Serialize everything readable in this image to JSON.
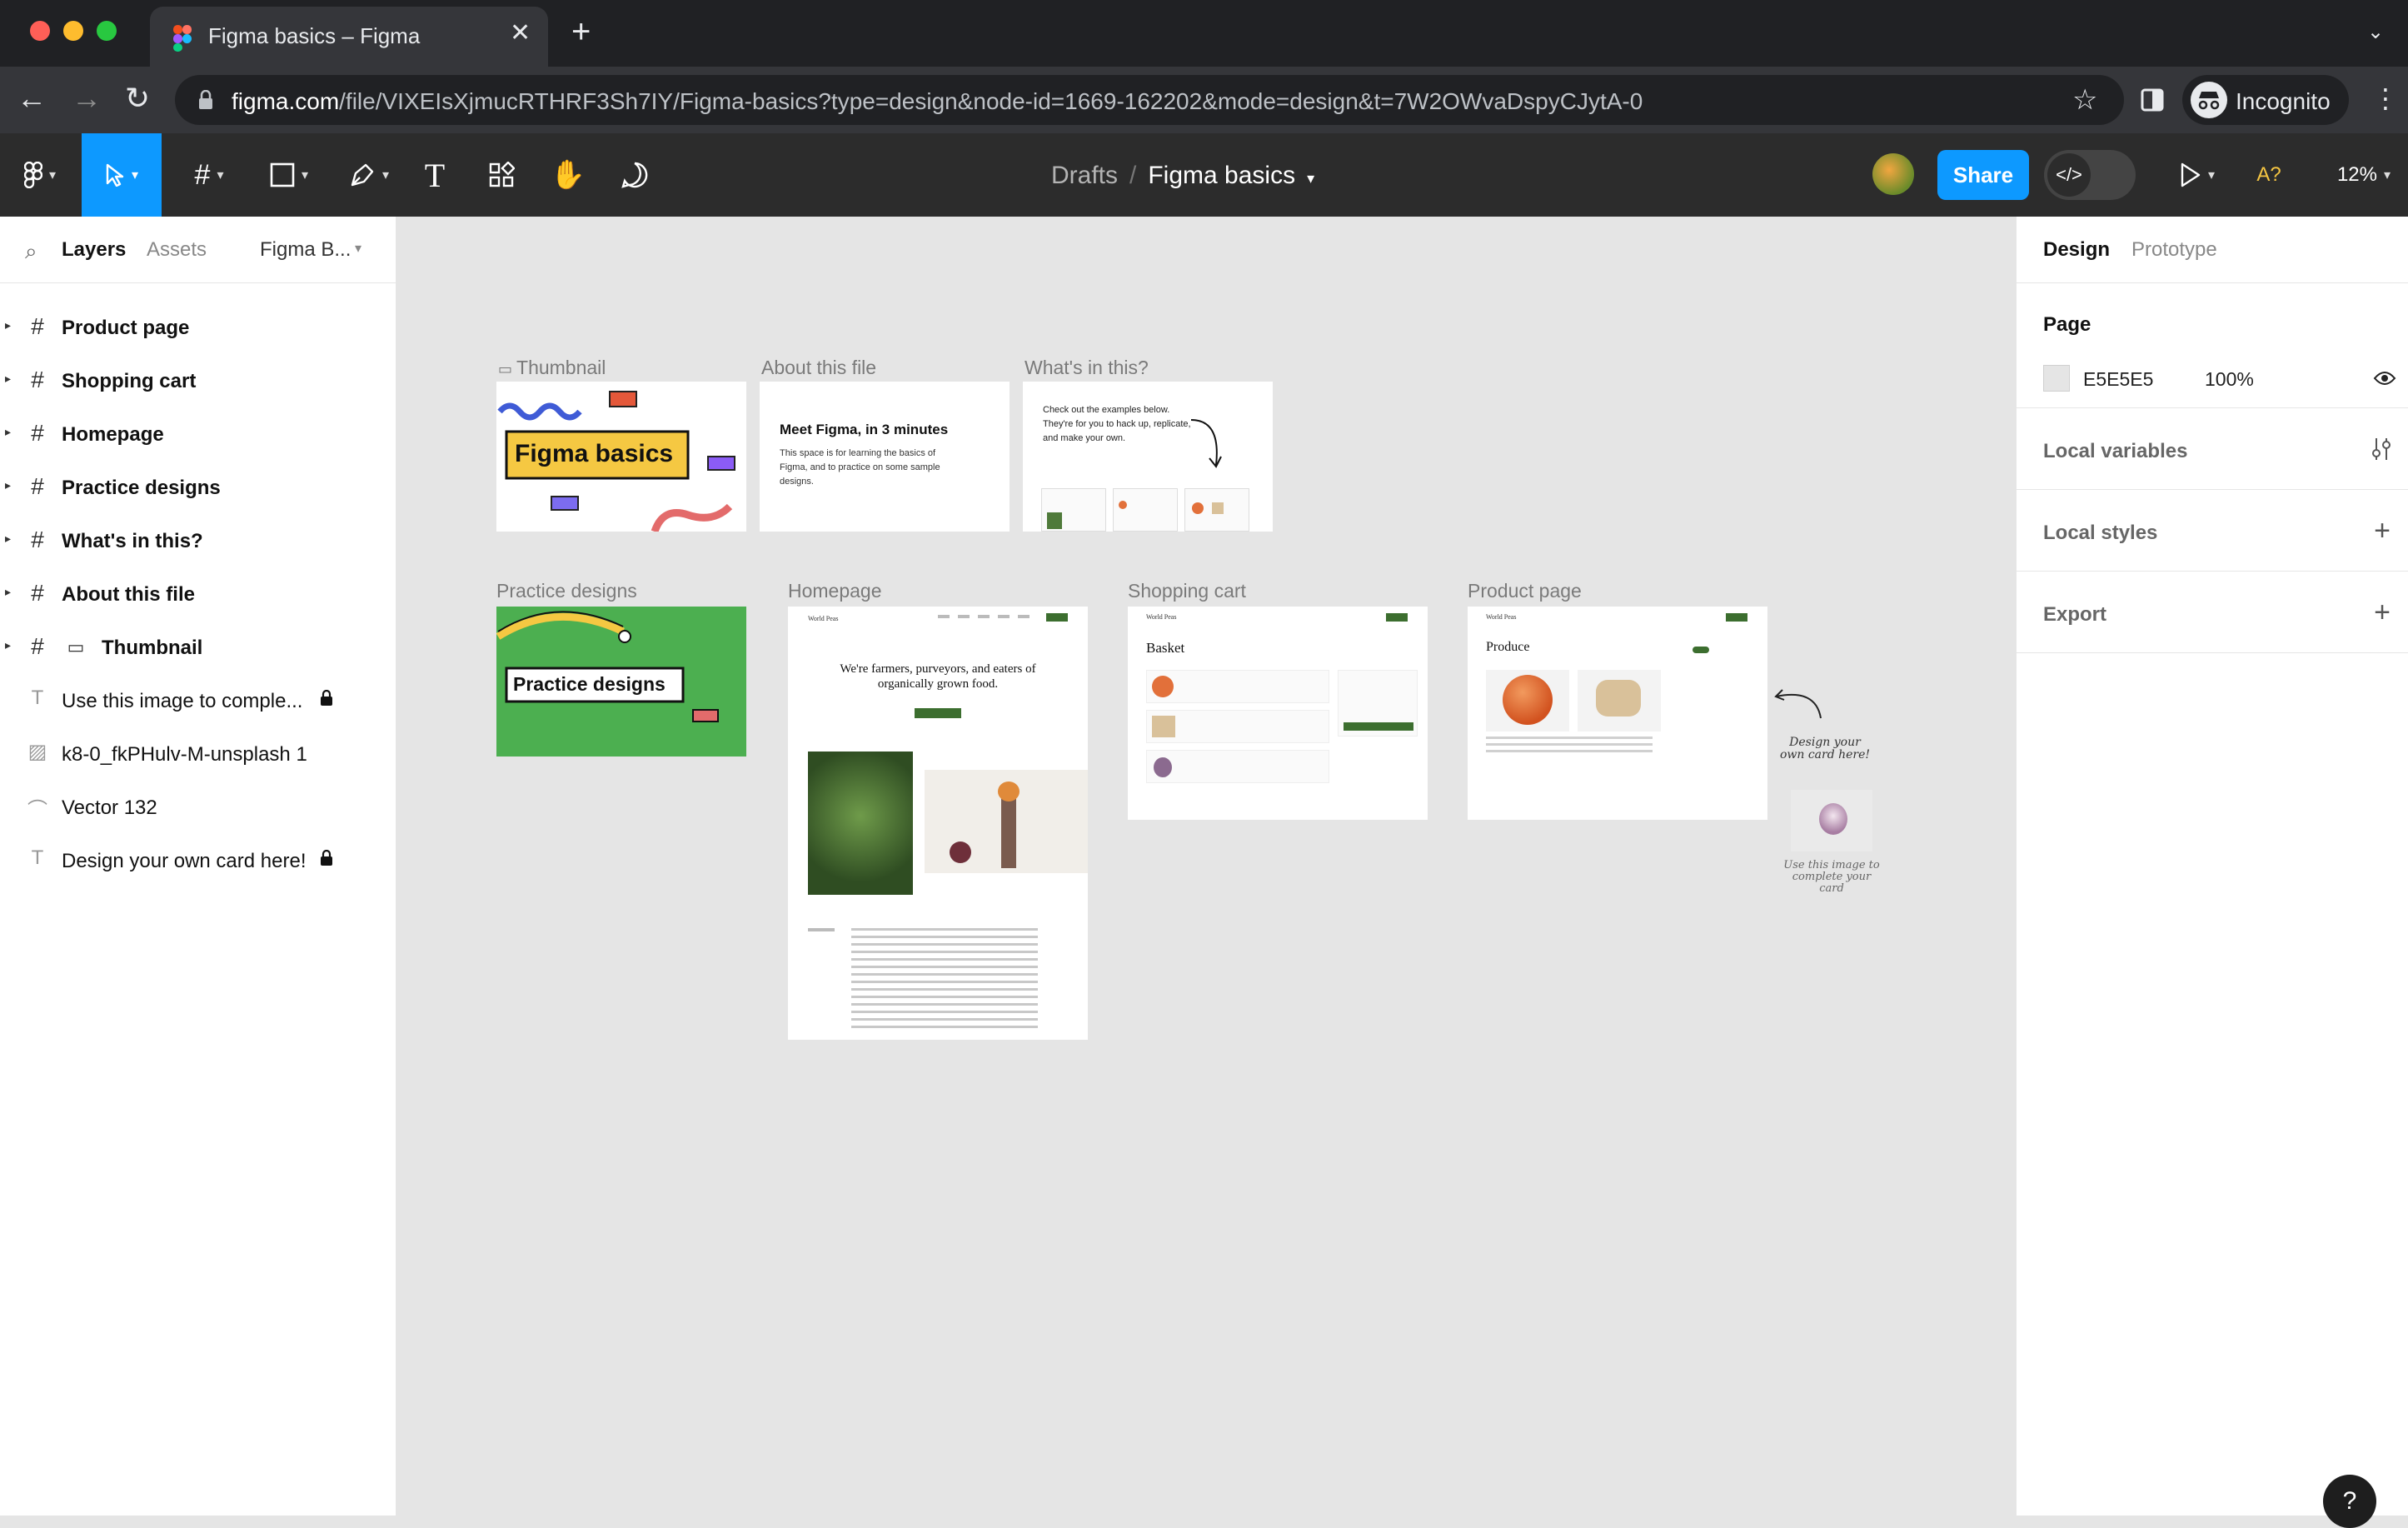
{
  "browser": {
    "tab_title": "Figma basics – Figma",
    "url_host": "figma.com",
    "url_path": "/file/VIXEIsXjmucRTHRF3Sh7IY/Figma-basics?type=design&node-id=1669-162202&mode=design&t=7W2OWvaDspyCJytA-0",
    "profile_label": "Incognito"
  },
  "toolbar": {
    "breadcrumb_parent": "Drafts",
    "breadcrumb_sep": "/",
    "file_name": "Figma basics",
    "share_label": "Share",
    "accessibility_label": "A?",
    "zoom": "12%"
  },
  "left_panel": {
    "tabs": [
      "Layers",
      "Assets"
    ],
    "page_selector": "Figma B...",
    "layers": [
      {
        "name": "Product page",
        "icon": "frame-icon",
        "bold": true
      },
      {
        "name": "Shopping cart",
        "icon": "frame-icon",
        "bold": true
      },
      {
        "name": "Homepage",
        "icon": "frame-icon",
        "bold": true
      },
      {
        "name": "Practice designs",
        "icon": "frame-icon",
        "bold": true
      },
      {
        "name": "What's in this?",
        "icon": "frame-icon",
        "bold": true
      },
      {
        "name": "About this file",
        "icon": "frame-icon",
        "bold": true
      },
      {
        "name": "Thumbnail",
        "icon": "frame-icon",
        "bold": true
      },
      {
        "name": "Use this image to comple...",
        "icon": "text-icon",
        "bold": false,
        "locked": true
      },
      {
        "name": "k8-0_fkPHulv-M-unsplash 1",
        "icon": "image-icon",
        "bold": false
      },
      {
        "name": "Vector 132",
        "icon": "vector-icon",
        "bold": false
      },
      {
        "name": "Design your own card here!",
        "icon": "text-icon",
        "bold": false,
        "locked": true
      }
    ]
  },
  "right_panel": {
    "tabs": [
      "Design",
      "Prototype"
    ],
    "page_section": "Page",
    "page_color": "E5E5E5",
    "page_opacity": "100%",
    "sections": [
      "Local variables",
      "Local styles",
      "Export"
    ]
  },
  "canvas": {
    "frame_labels": {
      "thumbnail": "Thumbnail",
      "about": "About this file",
      "whats_in": "What's in this?",
      "practice": "Practice designs",
      "homepage": "Homepage",
      "cart": "Shopping cart",
      "product": "Product page"
    },
    "thumbnail_text": "Figma basics",
    "about_title": "Meet Figma, in 3 minutes",
    "about_body": "This space is for learning the basics of Figma, and to practice on some sample designs.",
    "whats_in_body": "Check out the examples below. They're for you to hack up, replicate, and make your own.",
    "practice_text": "Practice designs",
    "homepage_hero": "We're farmers, purveyors, and eaters of organically grown food.",
    "homepage_brand": "World Peas",
    "cart_title": "Basket",
    "product_title": "Produce",
    "note_design_card": "Design your own card here!",
    "note_use_image": "Use this image to complete your card"
  },
  "colors": {
    "accent": "#0d99ff",
    "practice_green": "#4caf50",
    "thumbnail_yellow": "#f5c842",
    "farm_green": "#3c6e2f"
  }
}
